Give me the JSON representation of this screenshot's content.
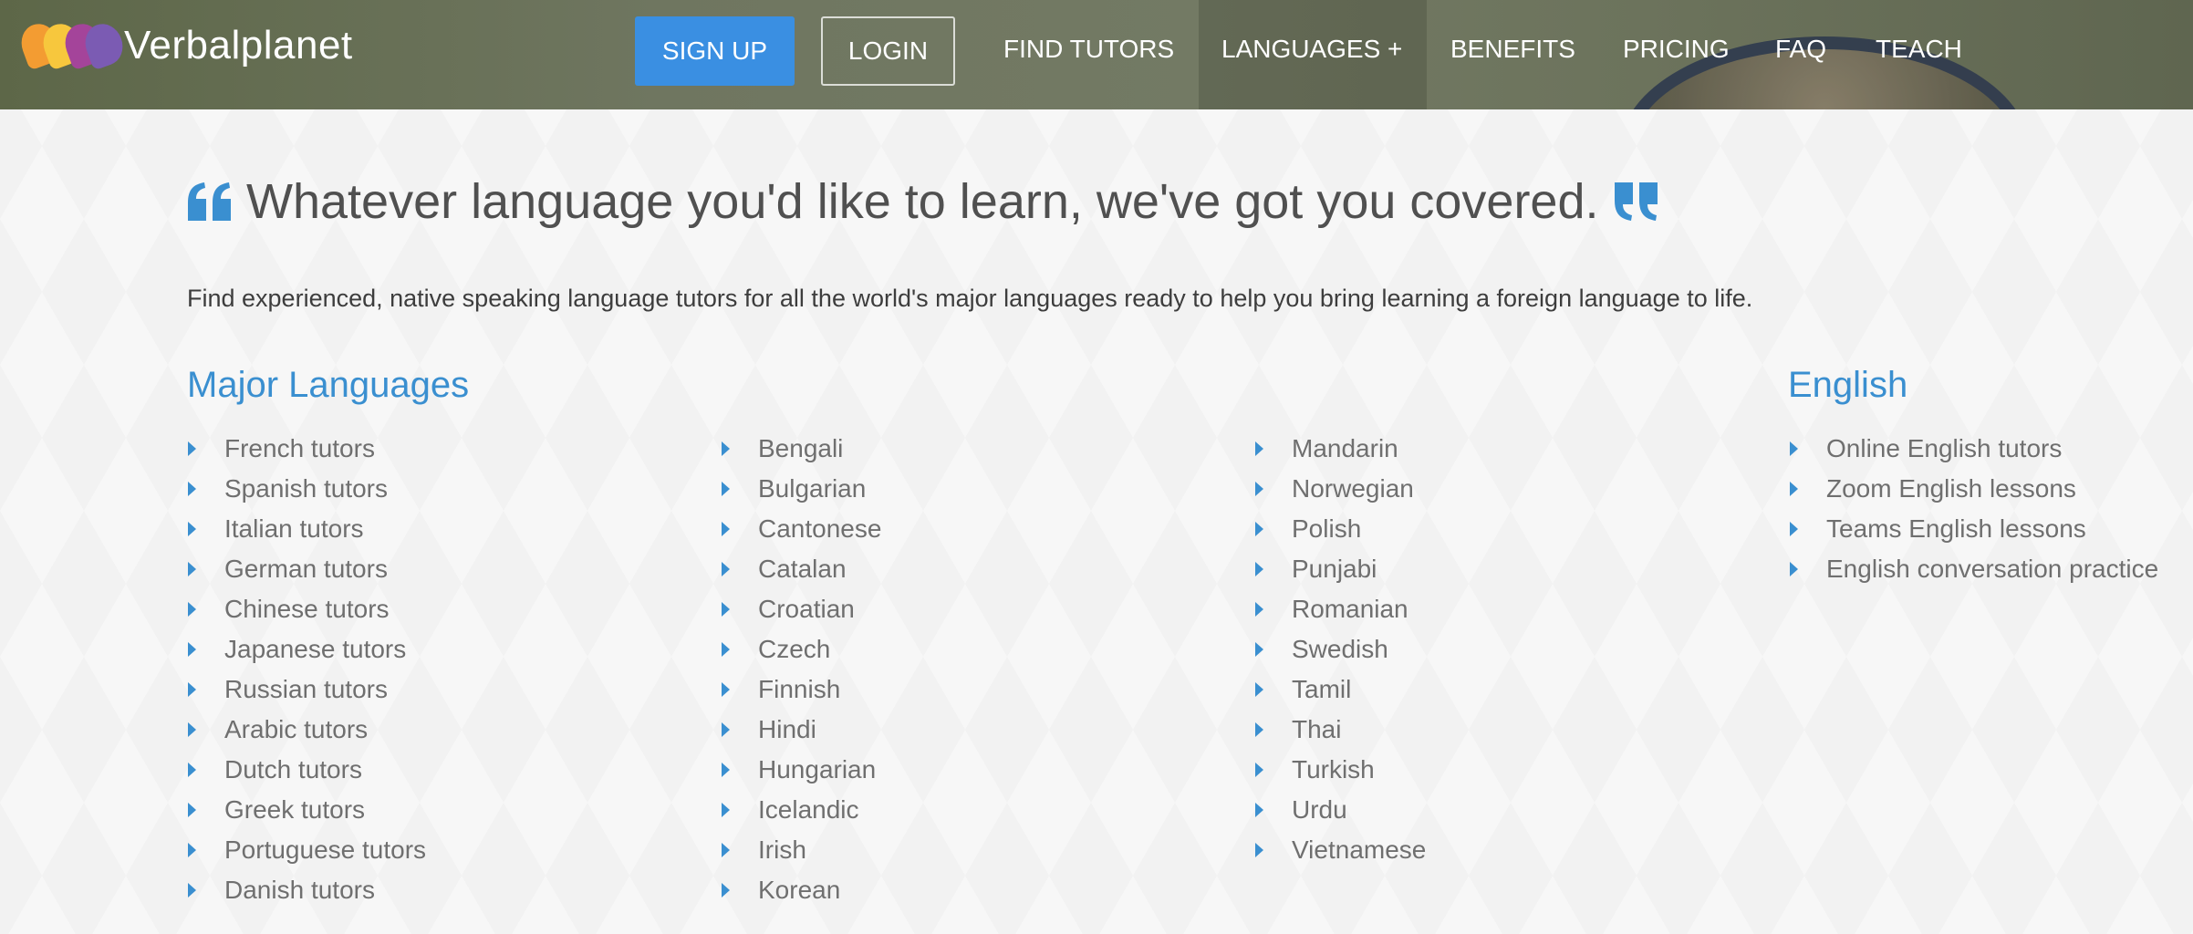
{
  "header": {
    "brand": "Verbalplanet",
    "signup_label": "SIGN UP",
    "login_label": "LOGIN",
    "nav": [
      "FIND TUTORS",
      "LANGUAGES +",
      "BENEFITS",
      "PRICING",
      "FAQ",
      "TEACH"
    ]
  },
  "main": {
    "headline": "Whatever language you'd like to learn, we've got you covered.",
    "intro": "Find experienced, native speaking language tutors for all the world's major languages ready to help you bring learning a foreign language to life.",
    "major_heading": "Major Languages",
    "english_heading": "English",
    "columns": [
      [
        "French tutors",
        "Spanish tutors",
        "Italian tutors",
        "German tutors",
        "Chinese tutors",
        "Japanese tutors",
        "Russian tutors",
        "Arabic tutors",
        "Dutch tutors",
        "Greek tutors",
        "Portuguese tutors",
        "Danish tutors"
      ],
      [
        "Bengali",
        "Bulgarian",
        "Cantonese",
        "Catalan",
        "Croatian",
        "Czech",
        "Finnish",
        "Hindi",
        "Hungarian",
        "Icelandic",
        "Irish",
        "Korean"
      ],
      [
        "Mandarin",
        "Norwegian",
        "Polish",
        "Punjabi",
        "Romanian",
        "Swedish",
        "Tamil",
        "Thai",
        "Turkish",
        "Urdu",
        "Vietnamese"
      ],
      [
        "Online English tutors",
        "Zoom English lessons",
        "Teams English lessons",
        "English conversation practice"
      ]
    ]
  },
  "colors": {
    "accent_blue": "#3a8fd0",
    "signup_blue": "#3a8fe2",
    "header_bg": "#6f7660",
    "body_text": "#505050",
    "link_text": "#6f6f6f"
  },
  "icons": {
    "open_quote": "open-quote-icon",
    "close_quote": "close-quote-icon",
    "list_bullet": "caret-right-icon",
    "logo": "verbalplanet-logo-icon"
  }
}
